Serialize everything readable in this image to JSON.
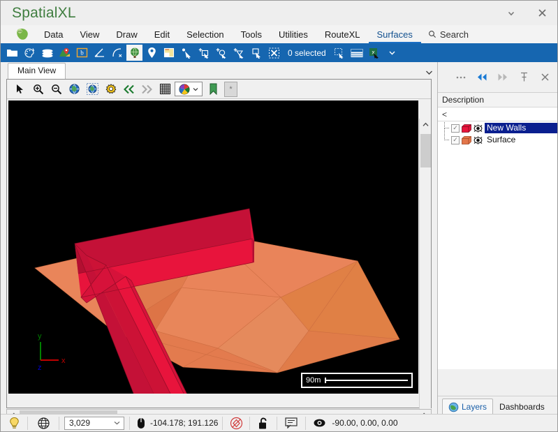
{
  "window": {
    "title": "SpatialXL",
    "minimize_label": "▾",
    "close_label": "✕"
  },
  "menubar": {
    "logo_icon": "globe-africa-icon",
    "items": [
      {
        "label": "Data",
        "active": false
      },
      {
        "label": "View",
        "active": false
      },
      {
        "label": "Draw",
        "active": false
      },
      {
        "label": "Edit",
        "active": false
      },
      {
        "label": "Selection",
        "active": false
      },
      {
        "label": "Tools",
        "active": false
      },
      {
        "label": "Utilities",
        "active": false
      },
      {
        "label": "RouteXL",
        "active": false
      },
      {
        "label": "Surfaces",
        "active": true
      }
    ],
    "search_label": "Search",
    "search_icon": "search-icon"
  },
  "ribbon": {
    "status_label": "0 selected",
    "icons": [
      "open-folder-icon",
      "palette-pin-icon",
      "layers-stack-icon",
      "map-pin-image-icon",
      "boundary-box-icon",
      "measure-angle-icon",
      "curve-tool-icon",
      "globe-view-icon",
      "location-pin-icon",
      "page-note-icon",
      "select-point-icon",
      "select-rect-add-icon",
      "select-circle-add-icon",
      "select-lasso-add-icon",
      "select-rect-remove-icon",
      "clear-selection-icon"
    ],
    "after_icons": [
      "copy-selection-icon",
      "table-view-icon",
      "excel-export-icon"
    ],
    "overflow_icon": "chevron-down-icon"
  },
  "document": {
    "tab_label": "Main View",
    "tab_overflow_icon": "chevron-down-icon"
  },
  "view_toolbar": {
    "icons": [
      "arrow-select-icon",
      "zoom-in-icon",
      "zoom-out-icon",
      "zoom-extents-globe-icon",
      "zoom-selection-globe-icon",
      "view-settings-gear-icon",
      "previous-view-icon",
      "next-view-icon",
      "grid-icon",
      "color-palette-icon",
      "bookmark-icon",
      "more-options-icon"
    ],
    "more_label": "*"
  },
  "canvas": {
    "background": "#000000",
    "axis": {
      "x_label": "x",
      "y_label": "y",
      "z_label": "z",
      "x_color": "#c00000",
      "y_color": "#008000",
      "z_color": "#0000cd"
    },
    "scalebar": {
      "label": "90m"
    },
    "colors": {
      "surface_top": "#e8834f",
      "surface_mid": "#e3764a",
      "surface_dark": "#d96a3f",
      "wall_bright": "#e8143c",
      "wall_dark": "#c41137",
      "wall_mid": "#d6123a"
    }
  },
  "dock": {
    "header_buttons": [
      {
        "name": "more-options-icon",
        "glyph": "•••",
        "style": "grey"
      },
      {
        "name": "collapse-left-icon",
        "glyph": "◀◀",
        "style": "blue"
      },
      {
        "name": "expand-right-icon",
        "glyph": "▶▶",
        "style": "grey"
      },
      {
        "name": "pin-icon",
        "glyph": "⚐",
        "style": "grey"
      },
      {
        "name": "close-icon",
        "glyph": "✕",
        "style": "grey"
      }
    ],
    "column_header": "Description",
    "filter_glyph": "<",
    "tree": [
      {
        "label": "New Walls",
        "checked": true,
        "selected": true,
        "swatch": "#e8143c",
        "eye": true
      },
      {
        "label": "Surface",
        "checked": true,
        "selected": false,
        "swatch": "#e3764a",
        "eye": true
      }
    ],
    "tabs": [
      {
        "label": "Layers",
        "active": true,
        "icon": "globe-icon"
      },
      {
        "label": "Dashboards",
        "active": false,
        "icon": ""
      }
    ]
  },
  "statusbar": {
    "lightbulb_icon": "lightbulb-icon",
    "globe_icon": "globe-wire-icon",
    "scale_value": "3,029",
    "mouse_icon": "mouse-icon",
    "coordinates": "-104.178; 191.126",
    "snap_icon": "snap-warning-icon",
    "lock_icon": "unlock-icon",
    "note_icon": "message-icon",
    "eye_icon": "eye-icon",
    "orientation": "-90.00, 0.00, 0.00"
  }
}
